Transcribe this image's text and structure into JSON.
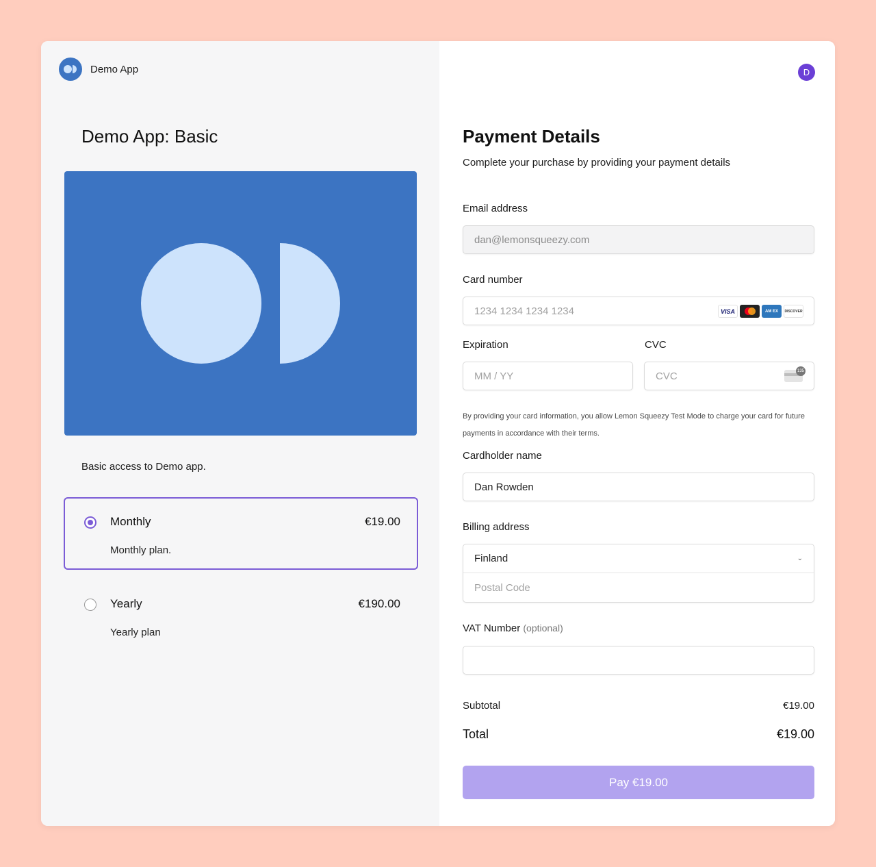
{
  "brand": {
    "name": "Demo App"
  },
  "product": {
    "title": "Demo App: Basic",
    "description": "Basic access to Demo app."
  },
  "plans": [
    {
      "name": "Monthly",
      "price": "€19.00",
      "description": "Monthly plan.",
      "selected": true
    },
    {
      "name": "Yearly",
      "price": "€190.00",
      "description": "Yearly plan",
      "selected": false
    }
  ],
  "user": {
    "initial": "D"
  },
  "payment": {
    "title": "Payment Details",
    "subtitle": "Complete your purchase by providing your payment details",
    "email_label": "Email address",
    "email_value": "dan@lemonsqueezy.com",
    "card_label": "Card number",
    "card_placeholder": "1234 1234 1234 1234",
    "card_brands": {
      "visa": "VISA",
      "amex": "AM EX",
      "discover": "DISCOVER"
    },
    "expiration_label": "Expiration",
    "expiration_placeholder": "MM / YY",
    "cvc_label": "CVC",
    "cvc_placeholder": "CVC",
    "cvc_badge": "135",
    "notice": "By providing your card information, you allow Lemon Squeezy Test Mode to charge your card for future payments in accordance with their terms.",
    "cardholder_label": "Cardholder name",
    "cardholder_value": "Dan Rowden",
    "billing_label": "Billing address",
    "country_value": "Finland",
    "postal_placeholder": "Postal Code",
    "vat_label": "VAT Number",
    "vat_optional": "(optional)",
    "vat_value": "",
    "subtotal_label": "Subtotal",
    "subtotal_value": "€19.00",
    "total_label": "Total",
    "total_value": "€19.00",
    "pay_button": "Pay €19.00"
  },
  "colors": {
    "background": "#FFCDBE",
    "brand_blue": "#3C74C2",
    "accent_purple": "#7B5CD6",
    "pay_button": "#B2A3EF"
  }
}
